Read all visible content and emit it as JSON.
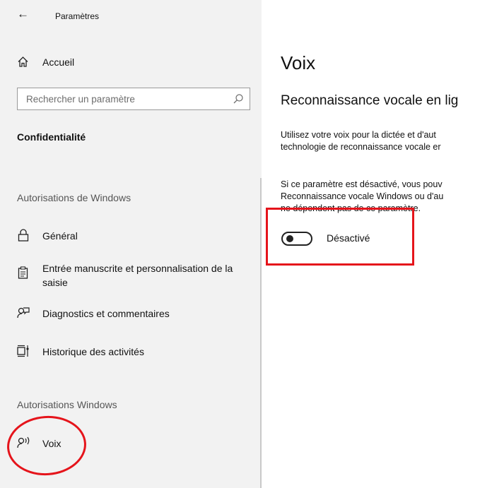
{
  "window": {
    "title": "Paramètres"
  },
  "sidebar": {
    "home_label": "Accueil",
    "search_placeholder": "Rechercher un paramètre",
    "section_title": "Confidentialité",
    "group1_header": "Autorisations de Windows",
    "items": [
      {
        "label": "Général",
        "icon": "lock-icon"
      },
      {
        "label_line1": "Entrée manuscrite et personnalisation de la",
        "label_line2": "saisie",
        "icon": "clipboard-icon"
      },
      {
        "label": "Diagnostics et commentaires",
        "icon": "feedback-icon"
      },
      {
        "label": "Historique des activités",
        "icon": "timeline-icon"
      }
    ],
    "group2_header": "Autorisations Windows",
    "voice_item": {
      "label": "Voix",
      "icon": "speech-icon"
    }
  },
  "main": {
    "page_title": "Voix",
    "section_title": "Reconnaissance vocale en lig",
    "para1_line1": "Utilisez votre voix pour la dictée et d'aut",
    "para1_line2": "technologie de reconnaissance vocale er",
    "para2_line1": "Si ce paramètre est désactivé, vous pouv",
    "para2_line2": "Reconnaissance vocale Windows ou d'au",
    "para2_line3": "ne dépendent pas de ce paramètre.",
    "toggle": {
      "state": "off",
      "label": "Désactivé"
    }
  },
  "annotations": {
    "highlight_color": "#e5141b"
  },
  "colors": {
    "sidebar_bg": "#f2f2f2",
    "content_bg": "#ffffff"
  }
}
